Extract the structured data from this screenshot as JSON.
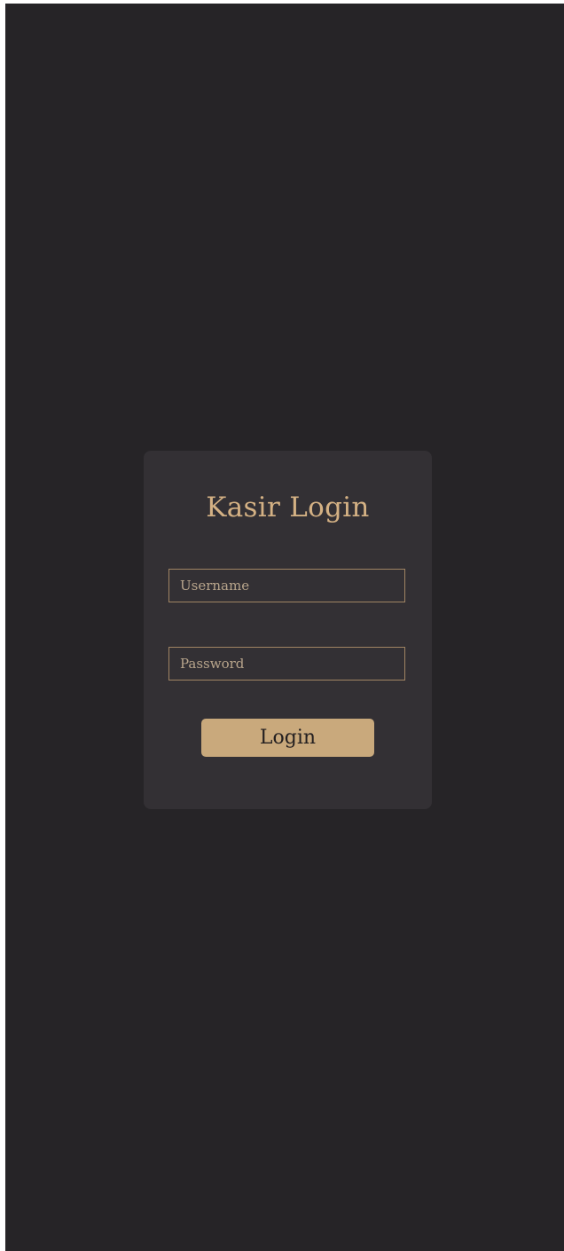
{
  "login_card": {
    "title": "Kasir Login",
    "username_placeholder": "Username",
    "password_placeholder": "Password",
    "login_label": "Login"
  },
  "colors": {
    "page_background": "#262427",
    "card_background": "#333034",
    "accent": "#d4b184",
    "button_background": "#c9a97c",
    "input_border": "#a08463"
  }
}
